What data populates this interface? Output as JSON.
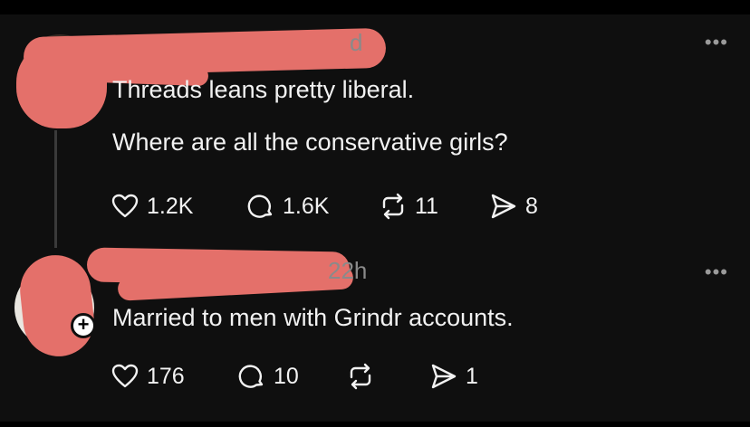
{
  "colors": {
    "background": "#0f0f0f",
    "text": "#f2f2f2",
    "muted": "#8a8a8a",
    "redaction": "#e4706a"
  },
  "posts": [
    {
      "time": "d",
      "lines": [
        "Threads leans pretty liberal.",
        "Where are all the conservative girls?"
      ],
      "more_icon": "ellipsis-icon",
      "actions": {
        "like": {
          "icon": "heart-icon",
          "count": "1.2K"
        },
        "reply": {
          "icon": "comment-icon",
          "count": "1.6K"
        },
        "repost": {
          "icon": "repost-icon",
          "count": "11"
        },
        "share": {
          "icon": "send-icon",
          "count": "8"
        }
      }
    },
    {
      "time": "22h",
      "lines": [
        "Married to men with Grindr accounts."
      ],
      "add_badge": "+",
      "more_icon": "ellipsis-icon",
      "actions": {
        "like": {
          "icon": "heart-icon",
          "count": "176"
        },
        "reply": {
          "icon": "comment-icon",
          "count": "10"
        },
        "repost": {
          "icon": "repost-icon",
          "count": ""
        },
        "share": {
          "icon": "send-icon",
          "count": "1"
        }
      }
    }
  ]
}
